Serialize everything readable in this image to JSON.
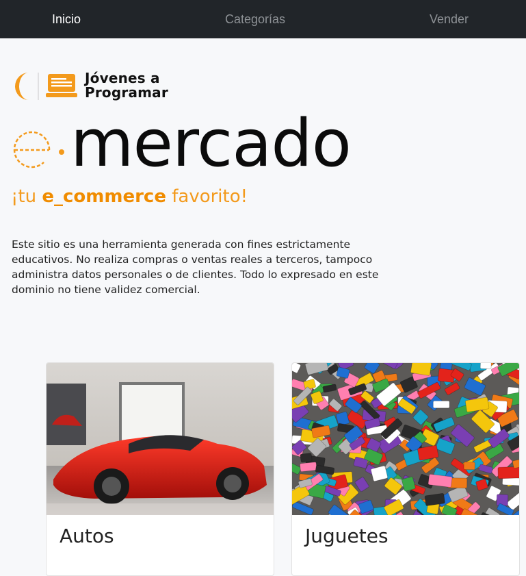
{
  "nav": {
    "items": [
      {
        "label": "Inicio"
      },
      {
        "label": "Categorías"
      },
      {
        "label": "Vender"
      }
    ]
  },
  "brand": {
    "jap_line1": "Jóvenes a",
    "jap_line2": "Programar",
    "title": "mercado",
    "tagline_prefix": "¡tu ",
    "tagline_bold": "e_commerce",
    "tagline_suffix": " favorito!",
    "accent_color": "#f39a1c"
  },
  "disclaimer": "Este sitio es una herramienta generada con fines estrictamente educativos. No realiza compras o ventas reales a terceros, tampoco administra datos personales o de clientes. Todo lo expresado en este dominio no tiene validez comercial.",
  "categories": [
    {
      "title": "Autos",
      "image": "red-sports-car-image"
    },
    {
      "title": "Juguetes",
      "image": "lego-bricks-image"
    }
  ]
}
